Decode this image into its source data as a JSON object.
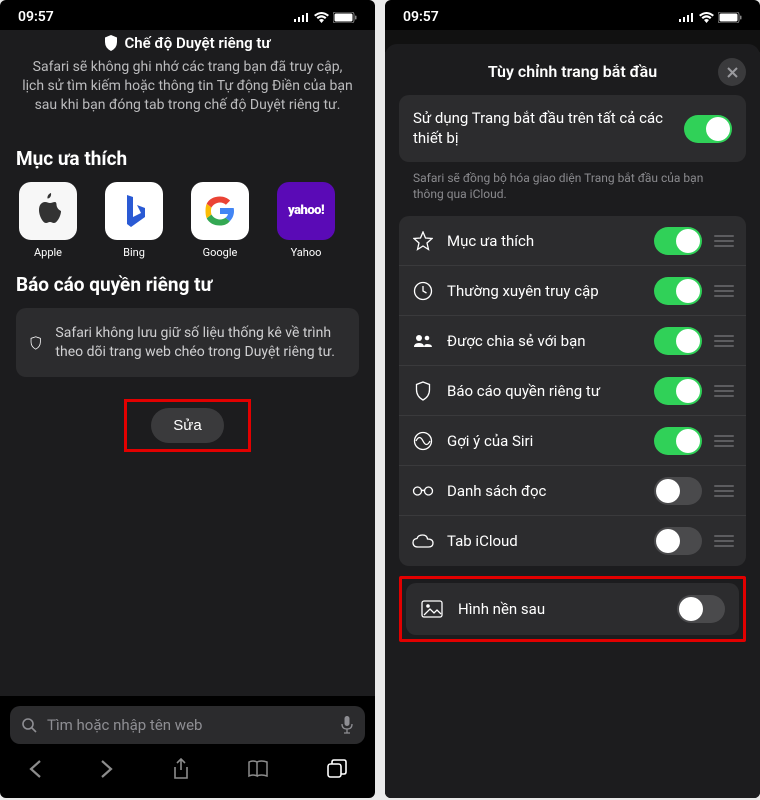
{
  "status": {
    "time": "09:57"
  },
  "left": {
    "private_title": "Chế độ Duyệt riêng tư",
    "private_desc": "Safari sẽ không ghi nhớ các trang bạn đã truy cập, lịch sử tìm kiếm hoặc thông tin Tự động Điền của bạn sau khi bạn đóng tab trong chế độ Duyệt riêng tư.",
    "favorites_title": "Mục ưa thích",
    "favorites": [
      {
        "label": "Apple"
      },
      {
        "label": "Bing"
      },
      {
        "label": "Google"
      },
      {
        "label": "Yahoo"
      }
    ],
    "privacy_title": "Báo cáo quyền riêng tư",
    "privacy_text": "Safari không lưu giữ số liệu thống kê về trình theo dõi trang web chéo trong Duyệt riêng tư.",
    "edit_label": "Sửa",
    "search_placeholder": "Tìm hoặc nhập tên web"
  },
  "right": {
    "sheet_title": "Tùy chỉnh trang bắt đầu",
    "sync_label": "Sử dụng Trang bắt đầu trên tất cả các thiết bị",
    "sync_hint": "Safari sẽ đồng bộ hóa giao diện Trang bắt đầu của bạn thông qua iCloud.",
    "options": [
      {
        "label": "Mục ưa thích",
        "on": true,
        "drag": true
      },
      {
        "label": "Thường xuyên truy cập",
        "on": true,
        "drag": true
      },
      {
        "label": "Được chia sẻ với bạn",
        "on": true,
        "drag": true
      },
      {
        "label": "Báo cáo quyền riêng tư",
        "on": true,
        "drag": true
      },
      {
        "label": "Gợi ý của Siri",
        "on": true,
        "drag": true
      },
      {
        "label": "Danh sách đọc",
        "on": false,
        "drag": true
      },
      {
        "label": "Tab iCloud",
        "on": false,
        "drag": true
      }
    ],
    "bg_label": "Hình nền sau",
    "bg_on": false
  }
}
